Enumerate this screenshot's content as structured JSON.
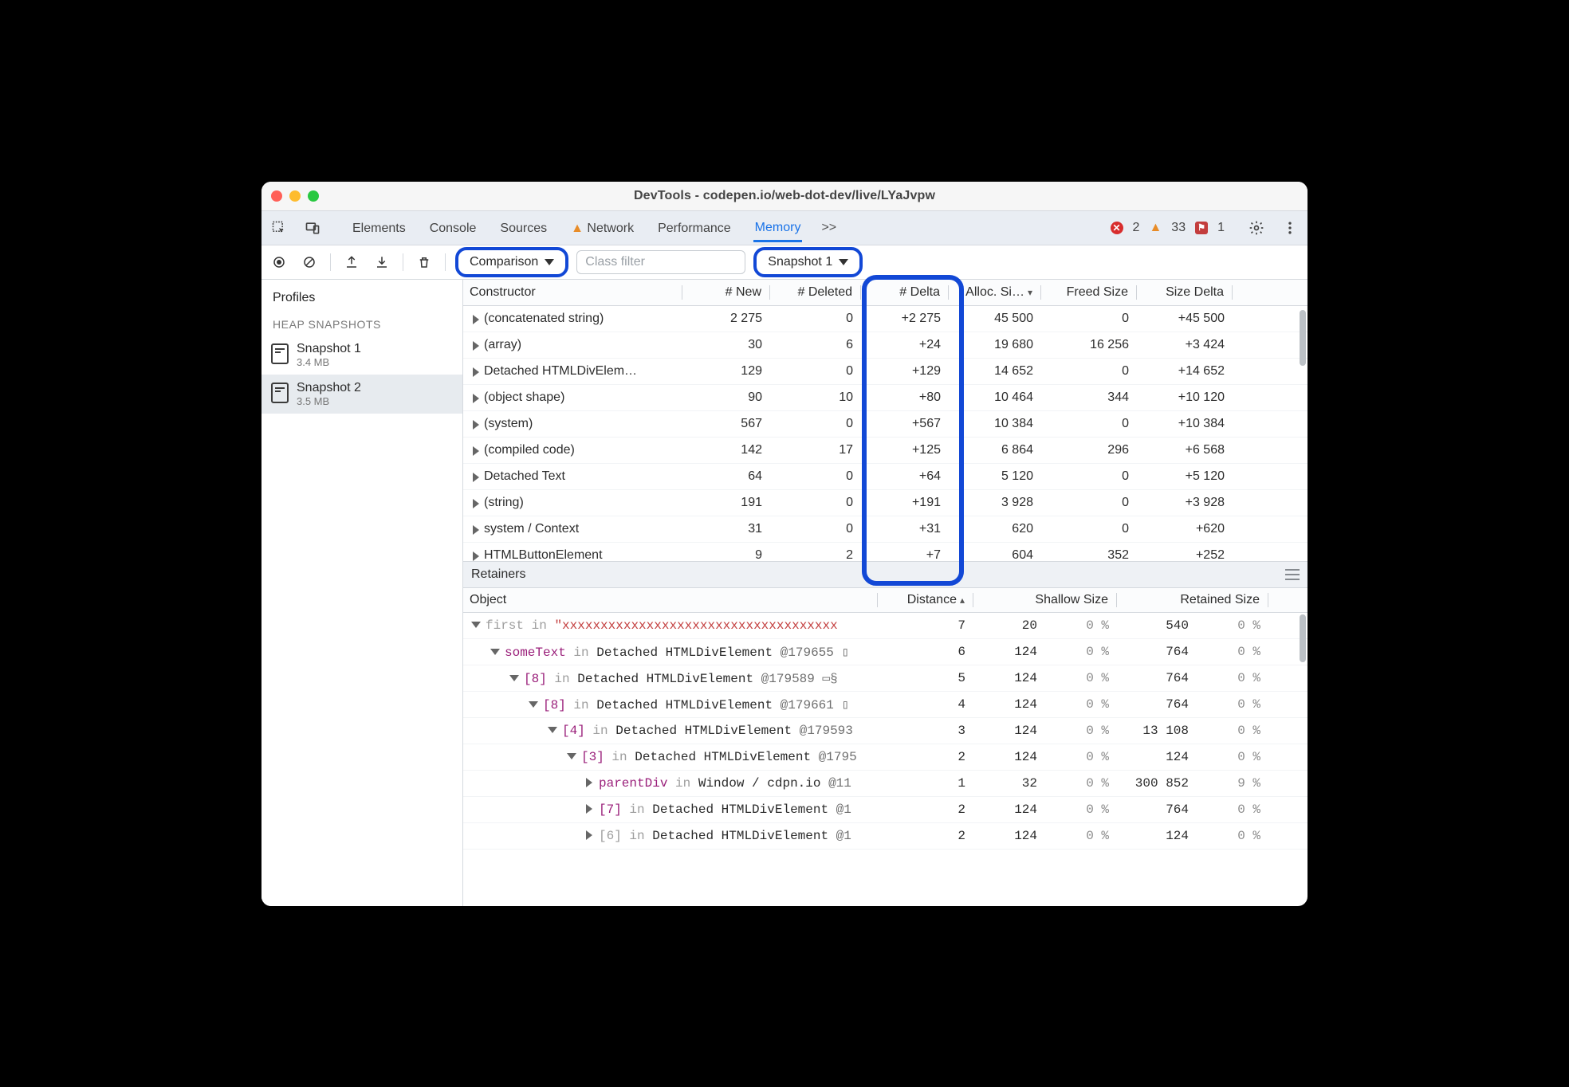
{
  "window": {
    "title": "DevTools - codepen.io/web-dot-dev/live/LYaJvpw"
  },
  "tabs": {
    "items": [
      "Elements",
      "Console",
      "Sources",
      "Network",
      "Performance",
      "Memory"
    ],
    "activeIndex": 5,
    "hasWarnOn": 3,
    "overflow": ">>"
  },
  "badges": {
    "errors": 2,
    "warnings": 33,
    "issues": 1
  },
  "toolbar": {
    "mode": "Comparison",
    "filterPlaceholder": "Class filter",
    "compareTo": "Snapshot 1"
  },
  "sidebar": {
    "title": "Profiles",
    "caption": "HEAP SNAPSHOTS",
    "snapshots": [
      {
        "name": "Snapshot 1",
        "size": "3.4 MB"
      },
      {
        "name": "Snapshot 2",
        "size": "3.5 MB"
      }
    ],
    "activeIndex": 1
  },
  "cols": [
    "Constructor",
    "# New",
    "# Deleted",
    "# Delta",
    "Alloc. Si…",
    "Freed Size",
    "Size Delta"
  ],
  "rows": [
    {
      "c": "(concatenated string)",
      "n": "2 275",
      "d": "0",
      "dl": "+2 275",
      "as": "45 500",
      "fs": "0",
      "sd": "+45 500"
    },
    {
      "c": "(array)",
      "n": "30",
      "d": "6",
      "dl": "+24",
      "as": "19 680",
      "fs": "16 256",
      "sd": "+3 424"
    },
    {
      "c": "Detached HTMLDivElem…",
      "n": "129",
      "d": "0",
      "dl": "+129",
      "as": "14 652",
      "fs": "0",
      "sd": "+14 652"
    },
    {
      "c": "(object shape)",
      "n": "90",
      "d": "10",
      "dl": "+80",
      "as": "10 464",
      "fs": "344",
      "sd": "+10 120"
    },
    {
      "c": "(system)",
      "n": "567",
      "d": "0",
      "dl": "+567",
      "as": "10 384",
      "fs": "0",
      "sd": "+10 384"
    },
    {
      "c": "(compiled code)",
      "n": "142",
      "d": "17",
      "dl": "+125",
      "as": "6 864",
      "fs": "296",
      "sd": "+6 568"
    },
    {
      "c": "Detached Text",
      "n": "64",
      "d": "0",
      "dl": "+64",
      "as": "5 120",
      "fs": "0",
      "sd": "+5 120"
    },
    {
      "c": "(string)",
      "n": "191",
      "d": "0",
      "dl": "+191",
      "as": "3 928",
      "fs": "0",
      "sd": "+3 928"
    },
    {
      "c": "system / Context",
      "n": "31",
      "d": "0",
      "dl": "+31",
      "as": "620",
      "fs": "0",
      "sd": "+620"
    },
    {
      "c": "HTMLButtonElement",
      "n": "9",
      "d": "2",
      "dl": "+7",
      "as": "604",
      "fs": "352",
      "sd": "+252"
    }
  ],
  "retainers": {
    "title": "Retainers",
    "cols": [
      "Object",
      "Distance",
      "Shallow Size",
      "Retained Size"
    ],
    "rows": [
      {
        "indent": 0,
        "open": true,
        "prop": "first",
        "inWord": "in",
        "tail": "\"xxxxxxxxxxxxxxxxxxxxxxxxxxxxxxxxxxxx",
        "tailCls": "str",
        "dist": "7",
        "sh": "20",
        "shp": "0 %",
        "ret": "540",
        "retp": "0 %",
        "gray": true
      },
      {
        "indent": 1,
        "open": true,
        "prop": "someText",
        "inWord": "in",
        "tail": " Detached HTMLDivElement @179655 ▯",
        "dist": "6",
        "sh": "124",
        "shp": "0 %",
        "ret": "764",
        "retp": "0 %"
      },
      {
        "indent": 2,
        "open": true,
        "prop": "[8]",
        "inWord": "in",
        "tail": " Detached HTMLDivElement @179589 ▭§",
        "dist": "5",
        "sh": "124",
        "shp": "0 %",
        "ret": "764",
        "retp": "0 %"
      },
      {
        "indent": 3,
        "open": true,
        "prop": "[8]",
        "inWord": "in",
        "tail": " Detached HTMLDivElement @179661 ▯",
        "dist": "4",
        "sh": "124",
        "shp": "0 %",
        "ret": "764",
        "retp": "0 %"
      },
      {
        "indent": 4,
        "open": true,
        "prop": "[4]",
        "inWord": "in",
        "tail": " Detached HTMLDivElement @179593",
        "dist": "3",
        "sh": "124",
        "shp": "0 %",
        "ret": "13 108",
        "retp": "0 %"
      },
      {
        "indent": 5,
        "open": true,
        "prop": "[3]",
        "inWord": "in",
        "tail": " Detached HTMLDivElement @1795",
        "dist": "2",
        "sh": "124",
        "shp": "0 %",
        "ret": "124",
        "retp": "0 %"
      },
      {
        "indent": 6,
        "open": false,
        "prop": "parentDiv",
        "inWord": "in",
        "tail": " Window / cdpn.io @11",
        "dist": "1",
        "sh": "32",
        "shp": "0 %",
        "ret": "300 852",
        "retp": "9 %"
      },
      {
        "indent": 6,
        "open": false,
        "prop": "[7]",
        "inWord": "in",
        "tail": " Detached HTMLDivElement @1",
        "dist": "2",
        "sh": "124",
        "shp": "0 %",
        "ret": "764",
        "retp": "0 %"
      },
      {
        "indent": 6,
        "open": false,
        "prop": "[6]",
        "inWord": "in",
        "tail": " Detached HTMLDivElement @1",
        "dist": "2",
        "sh": "124",
        "shp": "0 %",
        "ret": "124",
        "retp": "0 %",
        "gray": true
      }
    ]
  }
}
